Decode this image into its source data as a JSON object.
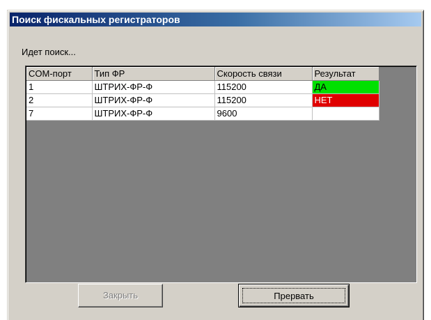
{
  "window": {
    "title": "Поиск фискальных регистраторов"
  },
  "status_text": "Идет поиск...",
  "table": {
    "columns": [
      "COM-порт",
      "Тип ФР",
      "Скорость связи",
      "Результат"
    ],
    "rows": [
      {
        "port": "1",
        "type": "ШТРИХ-ФР-Ф",
        "speed": "115200",
        "result": "ДА",
        "result_color": "#00e000"
      },
      {
        "port": "2",
        "type": "ШТРИХ-ФР-Ф",
        "speed": "115200",
        "result": "НЕТ",
        "result_color": "#e00000"
      },
      {
        "port": "7",
        "type": "ШТРИХ-ФР-Ф",
        "speed": "9600",
        "result": "",
        "result_color": "#ffffff"
      }
    ]
  },
  "buttons": {
    "close_label": "Закрыть",
    "close_enabled": false,
    "abort_label": "Прервать",
    "abort_enabled": true
  }
}
